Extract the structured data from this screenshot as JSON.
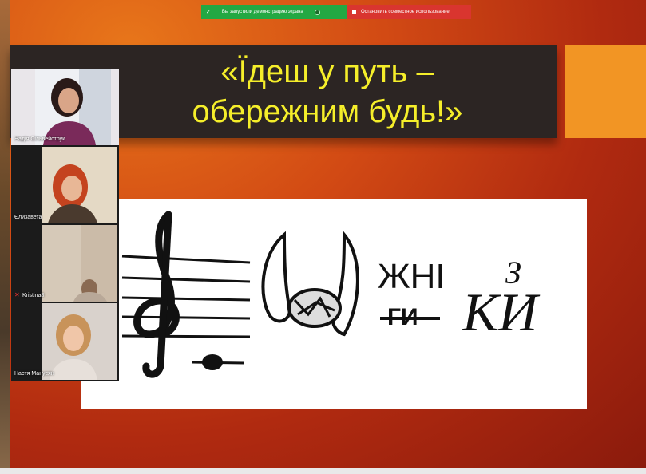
{
  "zoom_bar": {
    "share_status": "Вы запустили демонстрацию экрана",
    "stop_share": "Остановить совместное использование"
  },
  "slide": {
    "title_line1": "«Їдеш у путь –",
    "title_line2": "обережним будь!»",
    "rebus_text_top": "ЖНІ",
    "rebus_text_bottom": "ГИ",
    "rebus_script_top": "З",
    "rebus_script_bottom": "КИ"
  },
  "participants": [
    {
      "name": "Надія Сільвейструк",
      "muted": false
    },
    {
      "name": "Єлизавета",
      "muted": false
    },
    {
      "name": "Kristina8",
      "muted": true
    },
    {
      "name": "Настя Манусян",
      "muted": false
    }
  ],
  "colors": {
    "title_yellow": "#f5ee2a",
    "band": "#2c2523",
    "accent_orange": "#f29524",
    "zoom_green": "#23a843",
    "zoom_red": "#d9352f"
  }
}
